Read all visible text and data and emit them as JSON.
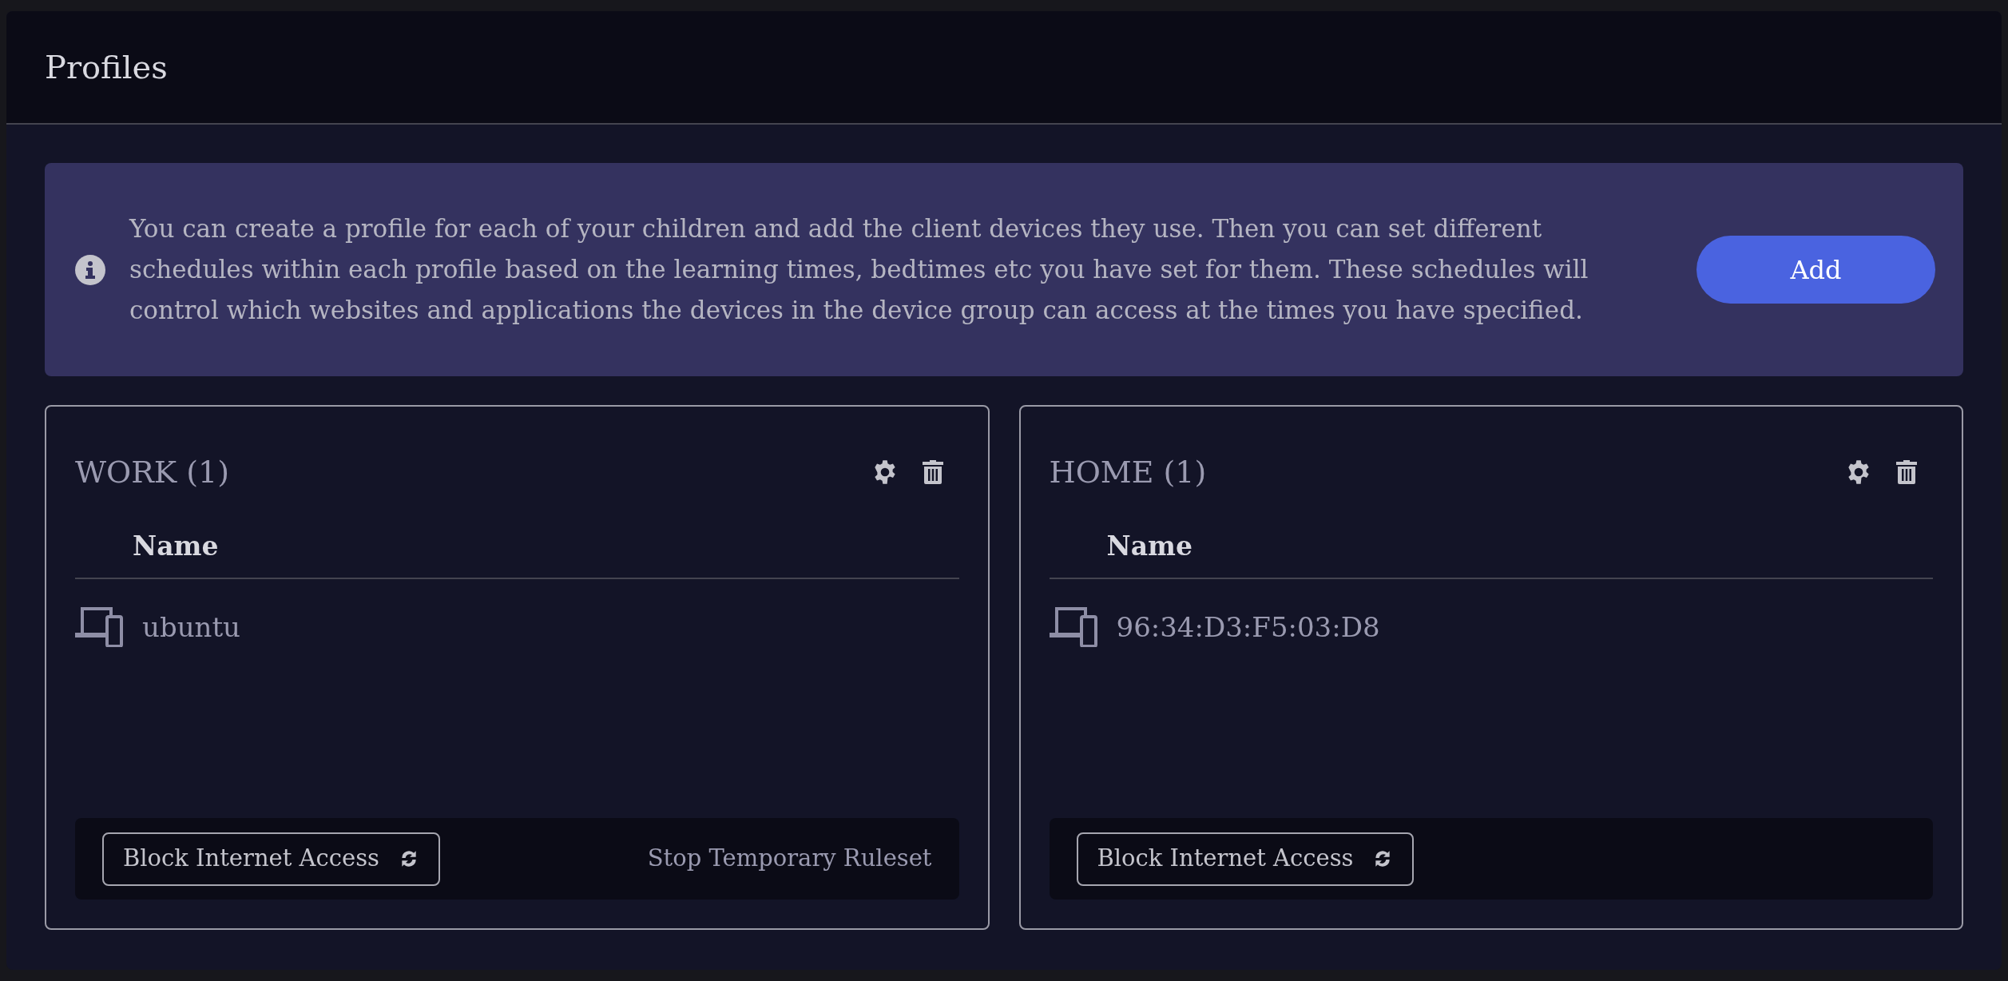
{
  "page_title": "Profiles",
  "info_banner": {
    "text": "You can create a profile for each of your children and add the client devices they use. Then you can set different schedules within each profile based on the learning times, bedtimes etc you have set for them. These schedules will control which websites and applications the devices in the device group can access at the times you have specified.",
    "button": "Add"
  },
  "profiles": [
    {
      "title": "WORK (1)",
      "column": "Name",
      "devices": [
        "ubuntu"
      ],
      "block_button": "Block Internet Access",
      "stop_link": "Stop Temporary Ruleset"
    },
    {
      "title": "HOME (1)",
      "column": "Name",
      "devices": [
        "96:34:D3:F5:03:D8"
      ],
      "block_button": "Block Internet Access"
    }
  ]
}
